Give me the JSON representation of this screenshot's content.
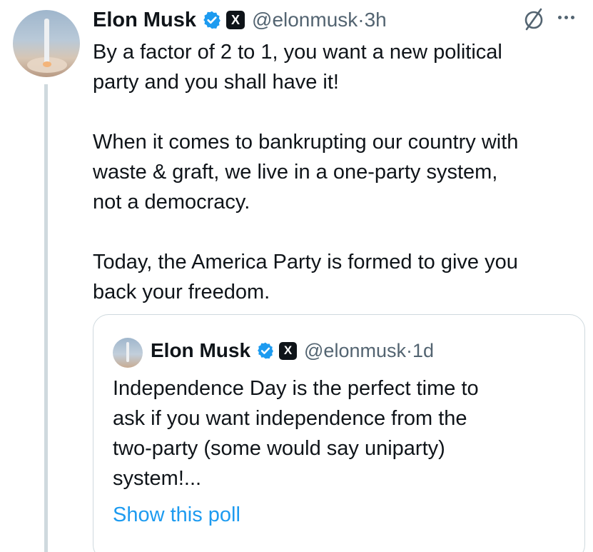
{
  "post": {
    "author_name": "Elon Musk",
    "handle": "@elonmusk",
    "separator": "·",
    "time": "3h",
    "badge_icon": "verified-badge-icon",
    "x_badge_text": "X",
    "lines": [
      "By a factor of 2 to 1, you want a new political",
      "party and you shall have it!",
      "",
      "When it comes to bankrupting our country with",
      "waste & graft, we live in a one-party system,",
      "not a democracy.",
      "",
      "Today, the America Party is formed to give you",
      "back your freedom."
    ]
  },
  "quote": {
    "author_name": "Elon Musk",
    "handle": "@elonmusk",
    "separator": "·",
    "time": "1d",
    "x_badge_text": "X",
    "lines": [
      "Independence Day is the perfect time to",
      "ask if you want independence from the",
      "two-party (some would say uniparty)",
      "system!..."
    ],
    "link_label": "Show this poll"
  },
  "colors": {
    "text": "#0f1419",
    "secondary": "#536471",
    "link": "#1d9bf0",
    "verified": "#1d9bf0",
    "border": "#cfd9de"
  }
}
